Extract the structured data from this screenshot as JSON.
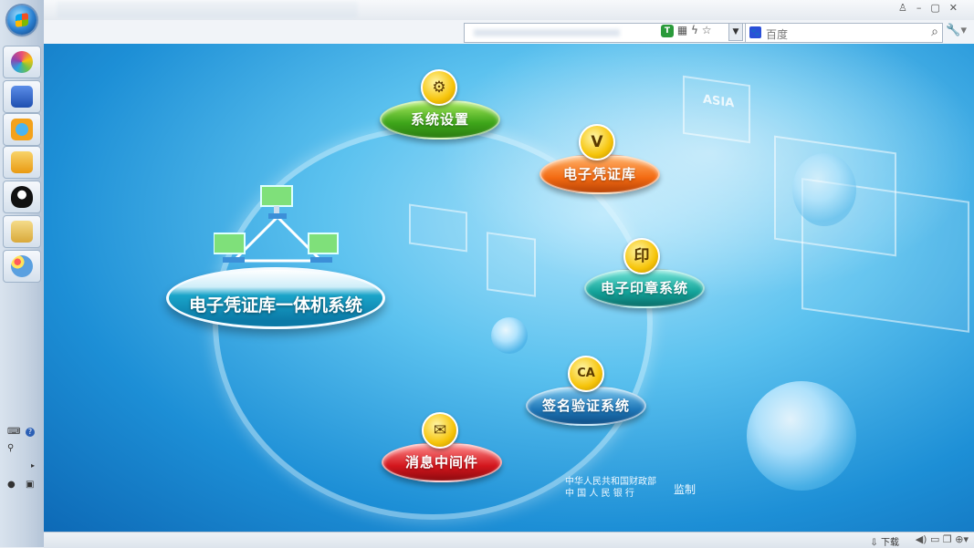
{
  "browser": {
    "search_placeholder": "百度",
    "status_download": "下载"
  },
  "taskbar": {
    "items": [
      {
        "icon": "pinwheel-app-icon",
        "color": "#e94e77"
      },
      {
        "icon": "computer-icon",
        "color": "#2f63c6"
      },
      {
        "icon": "browser-icon",
        "color": "#f3a21b"
      },
      {
        "icon": "mail-icon",
        "color": "#f0b93a"
      },
      {
        "icon": "qq-penguin-icon",
        "color": "#111111"
      },
      {
        "icon": "folder-icon",
        "color": "#e9c45a"
      },
      {
        "icon": "palette-icon",
        "color": "#5aa0e0"
      }
    ]
  },
  "main": {
    "system_title": "电子凭证库一体机系统",
    "nodes": [
      {
        "label": "系统设置",
        "icon": "gear-icon",
        "glyph": "⚙",
        "color": "green"
      },
      {
        "label": "电子凭证库",
        "icon": "shield-icon",
        "glyph": "V",
        "color": "orange"
      },
      {
        "label": "电子印章系统",
        "icon": "seal-icon",
        "glyph": "印",
        "color": "teal"
      },
      {
        "label": "签名验证系统",
        "icon": "ca-certificate-icon",
        "glyph": "CA",
        "color": "blue"
      },
      {
        "label": "消息中间件",
        "icon": "envelope-icon",
        "glyph": "✉",
        "color": "red"
      }
    ],
    "credits": {
      "line1": "中华人民共和国财政部",
      "line2": "中 国 人 民 银 行",
      "suffix": "监制"
    },
    "bg_text": "ASIA"
  },
  "colors": {
    "background_primary": "#1d8fd6",
    "background_light": "#aee4fb"
  }
}
